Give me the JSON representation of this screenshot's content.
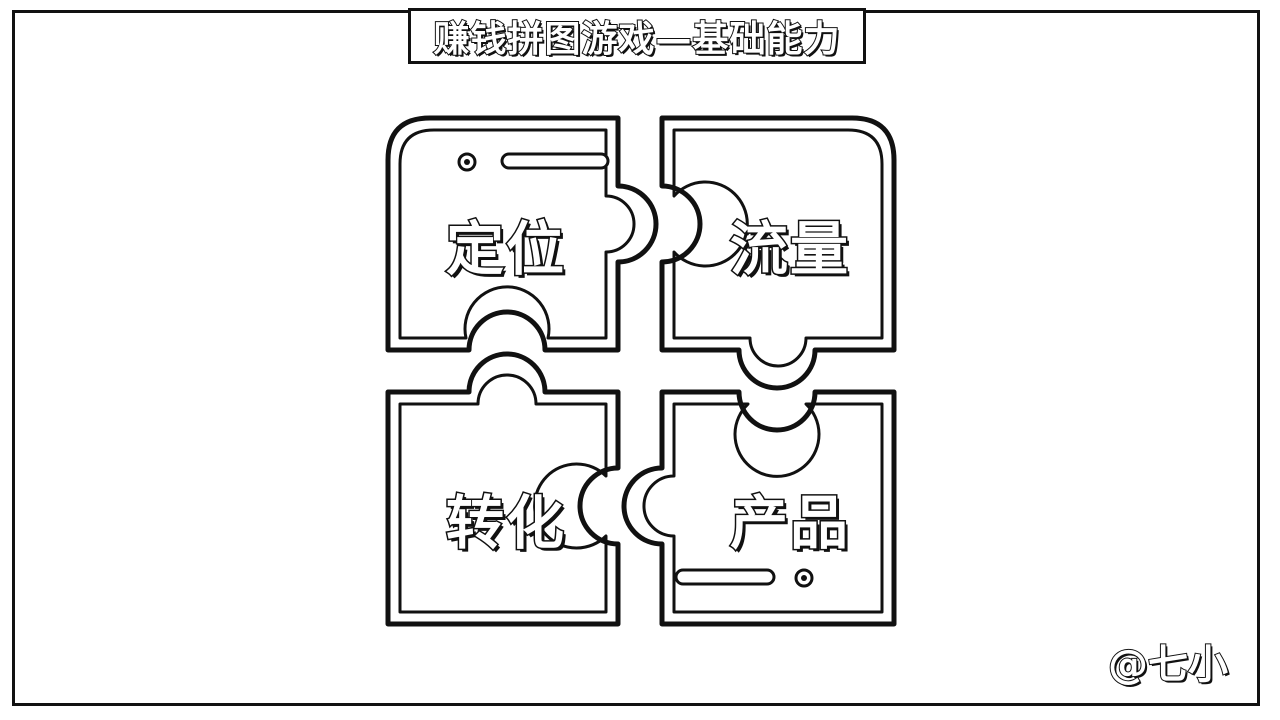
{
  "title": "赚钱拼图游戏—基础能力",
  "pieces": [
    {
      "position": "top-left",
      "label": "定位"
    },
    {
      "position": "top-right",
      "label": "流量"
    },
    {
      "position": "bottom-left",
      "label": "转化"
    },
    {
      "position": "bottom-right",
      "label": "产品"
    }
  ],
  "watermark": "@七小",
  "colors": {
    "stroke": "#111111",
    "fill": "#ffffff"
  }
}
